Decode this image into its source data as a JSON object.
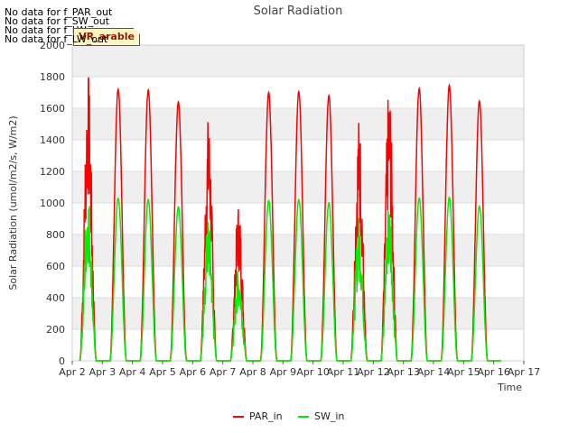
{
  "chart_data": {
    "type": "line",
    "title": "Solar Radiation",
    "xlabel": "Time",
    "ylabel": "Solar Radiation (umol/m2/s, W/m2)",
    "ylim": [
      0,
      2000
    ],
    "yticks": [
      0,
      200,
      400,
      600,
      800,
      1000,
      1200,
      1400,
      1600,
      1800,
      2000
    ],
    "xlim": [
      0,
      15
    ],
    "xtick_labels": [
      "Apr 2",
      "Apr 3",
      "Apr 4",
      "Apr 5",
      "Apr 6",
      "Apr 7",
      "Apr 8",
      "Apr 9",
      "Apr 10",
      "Apr 11",
      "Apr 12",
      "Apr 13",
      "Apr 14",
      "Apr 15",
      "Apr 16",
      "Apr 17"
    ],
    "grid": true,
    "legend_position": "bottom-center",
    "series": [
      {
        "name": "PAR_in",
        "color": "#ff0000",
        "daily_peaks": [
          {
            "date": "Apr 2",
            "peak": 1840
          },
          {
            "date": "Apr 3",
            "peak": 1720
          },
          {
            "date": "Apr 4",
            "peak": 1715
          },
          {
            "date": "Apr 5",
            "peak": 1640
          },
          {
            "date": "Apr 6",
            "peak": 1560
          },
          {
            "date": "Apr 7",
            "peak": 1010
          },
          {
            "date": "Apr 8",
            "peak": 1700
          },
          {
            "date": "Apr 9",
            "peak": 1705
          },
          {
            "date": "Apr 10",
            "peak": 1680
          },
          {
            "date": "Apr 11",
            "peak": 1560
          },
          {
            "date": "Apr 12",
            "peak": 1750
          },
          {
            "date": "Apr 13",
            "peak": 1725
          },
          {
            "date": "Apr 14",
            "peak": 1745
          },
          {
            "date": "Apr 15",
            "peak": 1645
          }
        ]
      },
      {
        "name": "SW_in",
        "color": "#00ee00",
        "daily_peaks": [
          {
            "date": "Apr 2",
            "peak": 1100
          },
          {
            "date": "Apr 3",
            "peak": 1030
          },
          {
            "date": "Apr 4",
            "peak": 1020
          },
          {
            "date": "Apr 5",
            "peak": 975
          },
          {
            "date": "Apr 6",
            "peak": 925
          },
          {
            "date": "Apr 7",
            "peak": 600
          },
          {
            "date": "Apr 8",
            "peak": 1015
          },
          {
            "date": "Apr 9",
            "peak": 1020
          },
          {
            "date": "Apr 10",
            "peak": 1000
          },
          {
            "date": "Apr 11",
            "peak": 930
          },
          {
            "date": "Apr 12",
            "peak": 1040
          },
          {
            "date": "Apr 13",
            "peak": 1030
          },
          {
            "date": "Apr 14",
            "peak": 1035
          },
          {
            "date": "Apr 15",
            "peak": 980
          }
        ]
      }
    ]
  },
  "nodata_messages": [
    "No data for f_PAR_out",
    "No data for f_SW_out",
    "No data for f_LW_in",
    "No data for f_LW_out"
  ],
  "badge_label": "VR_arable"
}
